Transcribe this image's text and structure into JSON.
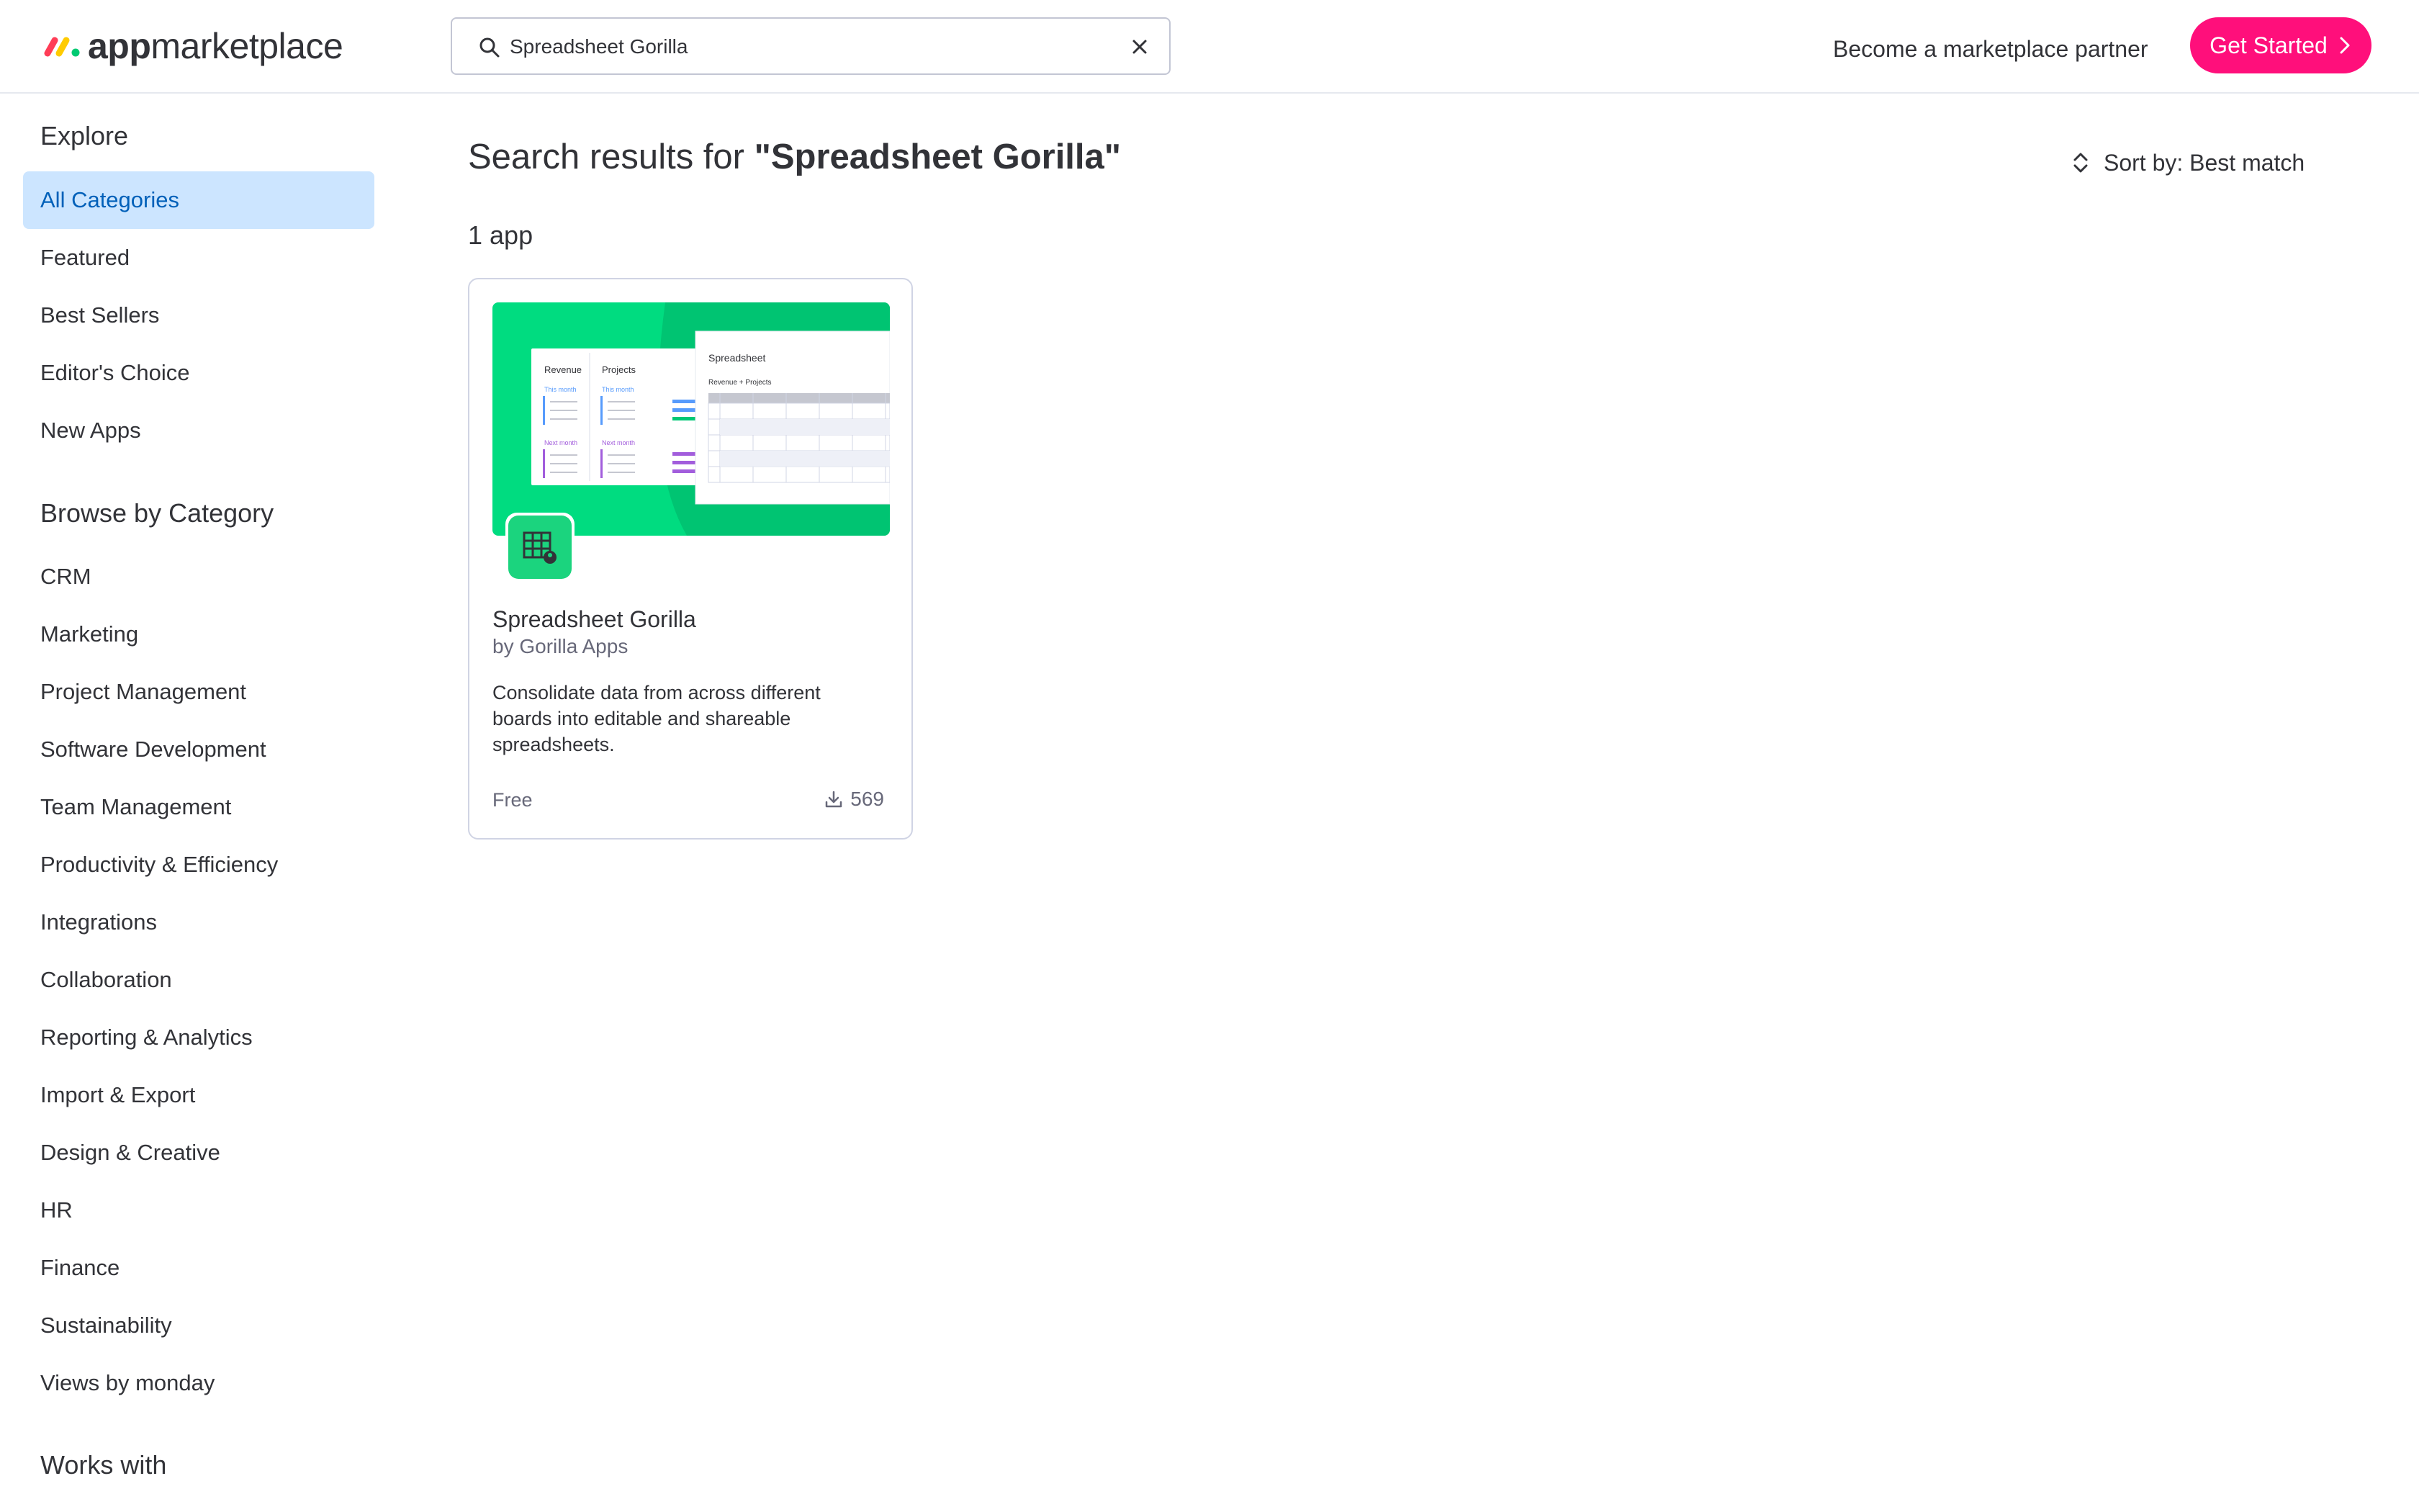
{
  "header": {
    "logo_bold": "app",
    "logo_rest": "marketplace",
    "search_value": "Spreadsheet Gorilla",
    "partner_link": "Become a marketplace partner",
    "cta": "Get Started"
  },
  "sidebar": {
    "explore_heading": "Explore",
    "explore_items": [
      "All Categories",
      "Featured",
      "Best Sellers",
      "Editor's Choice",
      "New Apps"
    ],
    "category_heading": "Browse by Category",
    "category_items": [
      "CRM",
      "Marketing",
      "Project Management",
      "Software Development",
      "Team Management",
      "Productivity & Efficiency",
      "Integrations",
      "Collaboration",
      "Reporting & Analytics",
      "Import & Export",
      "Design & Creative",
      "HR",
      "Finance",
      "Sustainability",
      "Views by monday"
    ],
    "works_with_heading": "Works with"
  },
  "main": {
    "title_prefix": "Search results for ",
    "title_query": "\"Spreadsheet Gorilla\"",
    "sort_label": "Sort by: Best match",
    "result_count": "1 app"
  },
  "card": {
    "title": "Spreadsheet Gorilla",
    "vendor": "by Gorilla Apps",
    "description": "Consolidate data from across different boards into editable and shareable spreadsheets.",
    "price": "Free",
    "installs": "569",
    "preview": {
      "col1": "Revenue",
      "col2": "Projects",
      "this_month": "This month",
      "next_month": "Next month",
      "sheet_title": "Spreadsheet",
      "sheet_subtitle": "Revenue + Projects"
    }
  },
  "colors": {
    "accent": "#ff0f7b",
    "active_bg": "#cce5ff",
    "active_text": "#0060b9",
    "preview_green": "#00dc80"
  }
}
